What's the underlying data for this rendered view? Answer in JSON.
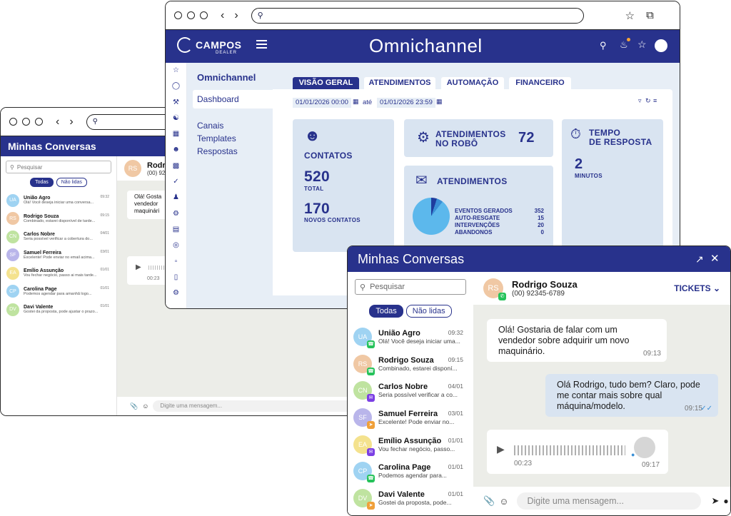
{
  "back_chat": {
    "title": "Minhas Conversas",
    "search_placeholder": "Pesquisar",
    "filter_all": "Todas",
    "filter_unread": "Não lidas",
    "header_initials": "RS",
    "header_name": "Rodr",
    "header_phone": "(00) 92",
    "bubble_text": "Olá! Gosta vendedor maquinári",
    "audio_time": "00:23",
    "input_placeholder": "Digite uma mensagem...",
    "conversations": [
      {
        "initials": "UA",
        "name": "União Agro",
        "preview": "Olá! Você deseja iniciar uma conversa...",
        "time": "09:32"
      },
      {
        "initials": "RS",
        "name": "Rodrigo Souza",
        "preview": "Combinado, estarei disponível de tarde...",
        "time": "09:15"
      },
      {
        "initials": "CN",
        "name": "Carlos Nobre",
        "preview": "Seria possível verificar a cobertura do...",
        "time": "04/01"
      },
      {
        "initials": "SF",
        "name": "Samuel Ferreira",
        "preview": "Excelente! Pode enviar no email acima...",
        "time": "03/01"
      },
      {
        "initials": "EA",
        "name": "Emílio Assunção",
        "preview": "Vou fechar negócio, passo ai mais tarde...",
        "time": "01/01"
      },
      {
        "initials": "CP",
        "name": "Carolina Page",
        "preview": "Podemos agendar para amanhã logo...",
        "time": "01/01"
      },
      {
        "initials": "DV",
        "name": "Davi Valente",
        "preview": "Gostei da proposta, pode ajustar o prazo...",
        "time": "01/01"
      }
    ]
  },
  "dashboard": {
    "logo_text": "CAMPOS",
    "logo_sub": "DEALER",
    "app_title": "Omnichannel",
    "menu_title": "Omnichannel",
    "menu_items": [
      "Dashboard",
      "Canais",
      "Templates",
      "Respostas"
    ],
    "tabs": [
      "VISÃO GERAL",
      "ATENDIMENTOS",
      "AUTOMAÇÃO",
      "FINANCEIRO"
    ],
    "date_from": "01/01/2026 00:00",
    "date_sep": "até",
    "date_to": "01/01/2026 23:59",
    "contacts": {
      "title": "CONTATOS",
      "total": "520",
      "total_label": "TOTAL",
      "new": "170",
      "new_label": "NOVOS CONTATOS"
    },
    "robot": {
      "title_line1": "ATENDIMENTOS",
      "title_line2": "NO ROBÔ",
      "value": "72"
    },
    "response": {
      "title_line1": "TEMPO",
      "title_line2": "DE RESPOSTA",
      "value": "2",
      "unit": "MINUTOS"
    },
    "attendances": {
      "title": "ATENDIMENTOS",
      "rows": [
        {
          "label": "EVENTOS GERADOS",
          "value": "352"
        },
        {
          "label": "AUTO-RESGATE",
          "value": "15"
        },
        {
          "label": "INTERVENÇÕES",
          "value": "20"
        },
        {
          "label": "ABANDONOS",
          "value": "0"
        }
      ]
    },
    "colors": {
      "brand": "#28328c",
      "card": "#d9e4f1",
      "bg": "#e7eef6"
    }
  },
  "front_chat": {
    "title": "Minhas Conversas",
    "search_placeholder": "Pesquisar",
    "filter_all": "Todas",
    "filter_unread": "Não lidas",
    "header_initials": "RS",
    "header_name": "Rodrigo Souza",
    "header_phone": "(00) 92345-6789",
    "tickets_label": "TICKETS",
    "msg_in": "Olá! Gostaria de falar com um vendedor sobre adquirir um novo maquinário.",
    "msg_in_time": "09:13",
    "msg_out": "Olá Rodrigo, tudo bem? Claro, pode me contar mais sobre qual máquina/modelo.",
    "msg_out_time": "09:15",
    "audio_duration": "00:23",
    "audio_time": "09:17",
    "input_placeholder": "Digite uma mensagem...",
    "conversations": [
      {
        "initials": "UA",
        "name": "União Agro",
        "preview": "Olá! Você deseja iniciar uma...",
        "time": "09:32",
        "channel": "whatsapp"
      },
      {
        "initials": "RS",
        "name": "Rodrigo Souza",
        "preview": "Combinado, estarei disponí...",
        "time": "09:15",
        "channel": "whatsapp"
      },
      {
        "initials": "CN",
        "name": "Carlos Nobre",
        "preview": "Seria possível verificar a co...",
        "time": "04/01",
        "channel": "messenger"
      },
      {
        "initials": "SF",
        "name": "Samuel Ferreira",
        "preview": "Excelente! Pode enviar no...",
        "time": "03/01",
        "channel": "telegram"
      },
      {
        "initials": "EA",
        "name": "Emílio Assunção",
        "preview": "Vou fechar negócio, passo...",
        "time": "01/01",
        "channel": "messenger"
      },
      {
        "initials": "CP",
        "name": "Carolina Page",
        "preview": "Podemos agendar para...",
        "time": "01/01",
        "channel": "whatsapp"
      },
      {
        "initials": "DV",
        "name": "Davi Valente",
        "preview": "Gostei da proposta, pode...",
        "time": "01/01",
        "channel": "telegram"
      }
    ]
  }
}
